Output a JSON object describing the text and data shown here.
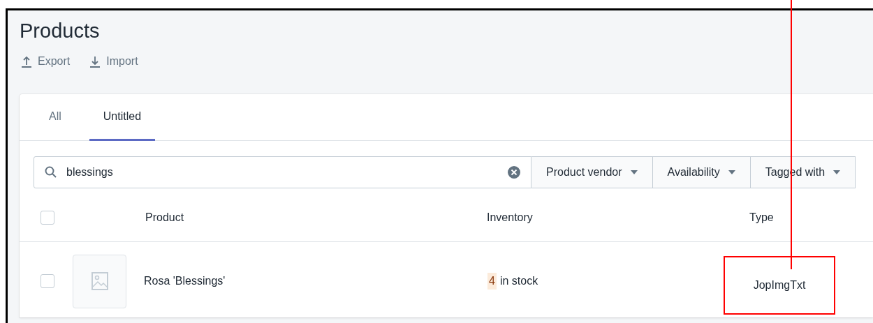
{
  "page_title": "Products",
  "actions": [
    {
      "kind": "export",
      "label": "Export"
    },
    {
      "kind": "import",
      "label": "Import"
    }
  ],
  "tabs": [
    {
      "label": "All",
      "selected": false
    },
    {
      "label": "Untitled",
      "selected": true
    }
  ],
  "search": {
    "value": "blessings"
  },
  "filters": [
    "Product vendor",
    "Availability",
    "Tagged with"
  ],
  "table": {
    "header_checked": false,
    "columns": [
      "Product",
      "Inventory",
      "Type"
    ],
    "rows": [
      {
        "checked": false,
        "product": "Rosa 'Blessings'",
        "inventory_count": "4",
        "inventory_text": "in stock",
        "low_stock": true,
        "type": "JopImgTxt",
        "type_highlighted": true
      }
    ]
  }
}
